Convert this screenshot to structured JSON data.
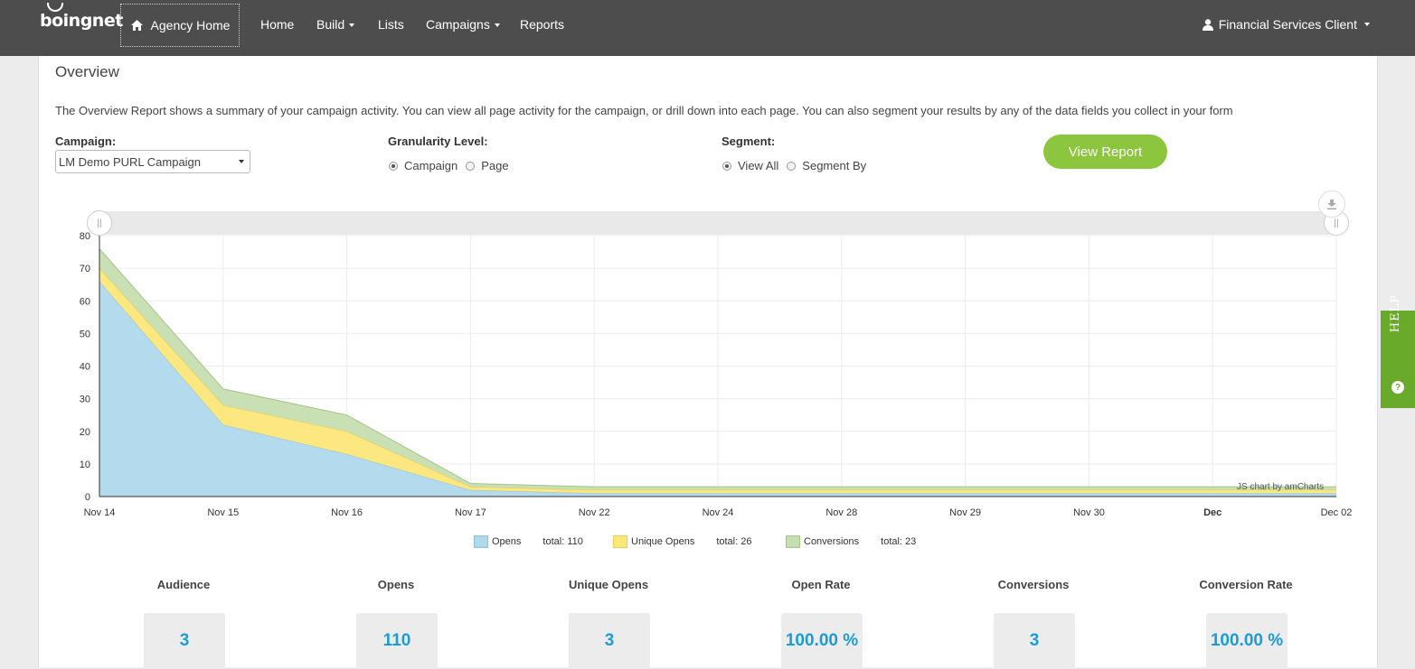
{
  "nav": {
    "logo_text": "boingnet",
    "agency_home": "Agency Home",
    "items": [
      {
        "label": "Home",
        "dropdown": false
      },
      {
        "label": "Build",
        "dropdown": true
      },
      {
        "label": "Lists",
        "dropdown": false
      },
      {
        "label": "Campaigns",
        "dropdown": true
      },
      {
        "label": "Reports",
        "dropdown": false
      }
    ],
    "user": "Financial Services Client"
  },
  "page": {
    "title": "Overview",
    "intro": "The Overview Report shows a summary of your campaign activity. You can view all page activity for the campaign, or drill down into each page. You can also segment your results by any of the data fields you collect in your form"
  },
  "filters": {
    "campaign_label": "Campaign:",
    "campaign_value": "LM Demo PURL Campaign",
    "granularity_label": "Granularity Level:",
    "granularity_options": [
      "Campaign",
      "Page"
    ],
    "granularity_selected": "Campaign",
    "segment_label": "Segment:",
    "segment_options": [
      "View All",
      "Segment By"
    ],
    "segment_selected": "View All",
    "view_report": "View Report"
  },
  "colors": {
    "opens": "#b0d9ec",
    "unique_opens": "#fde67a",
    "conversions": "#c6ddb0",
    "accent_green": "#8cc63f",
    "value_blue": "#1a9cd8"
  },
  "chart_data": {
    "type": "area",
    "stacked": true,
    "categories": [
      "Nov 14",
      "Nov 15",
      "Nov 16",
      "Nov 17",
      "Nov 22",
      "Nov 24",
      "Nov 28",
      "Nov 29",
      "Nov 30",
      "Dec",
      "Dec 02"
    ],
    "series": [
      {
        "name": "Opens",
        "total_label": "total: 110",
        "values": [
          66,
          22,
          13,
          2,
          1,
          1,
          1,
          1,
          1,
          1,
          1
        ]
      },
      {
        "name": "Unique Opens",
        "total_label": "total: 26",
        "values": [
          4,
          6,
          7,
          1,
          1,
          1,
          1,
          1,
          1,
          1,
          1
        ]
      },
      {
        "name": "Conversions",
        "total_label": "total: 23",
        "values": [
          6,
          5,
          5,
          1,
          1,
          1,
          1,
          1,
          1,
          1,
          1
        ]
      }
    ],
    "y_ticks": [
      0,
      10,
      20,
      30,
      40,
      50,
      60,
      70,
      80
    ],
    "ylim": [
      0,
      80
    ],
    "grid": true,
    "legend_position": "bottom",
    "credit": "JS chart by amCharts"
  },
  "stats": [
    {
      "label": "Audience",
      "value": "3"
    },
    {
      "label": "Opens",
      "value": "110"
    },
    {
      "label": "Unique Opens",
      "value": "3"
    },
    {
      "label": "Open Rate",
      "value": "100.00 %"
    },
    {
      "label": "Conversions",
      "value": "3"
    },
    {
      "label": "Conversion Rate",
      "value": "100.00 %"
    }
  ],
  "help": {
    "label": "HELP",
    "icon_text": "?"
  }
}
